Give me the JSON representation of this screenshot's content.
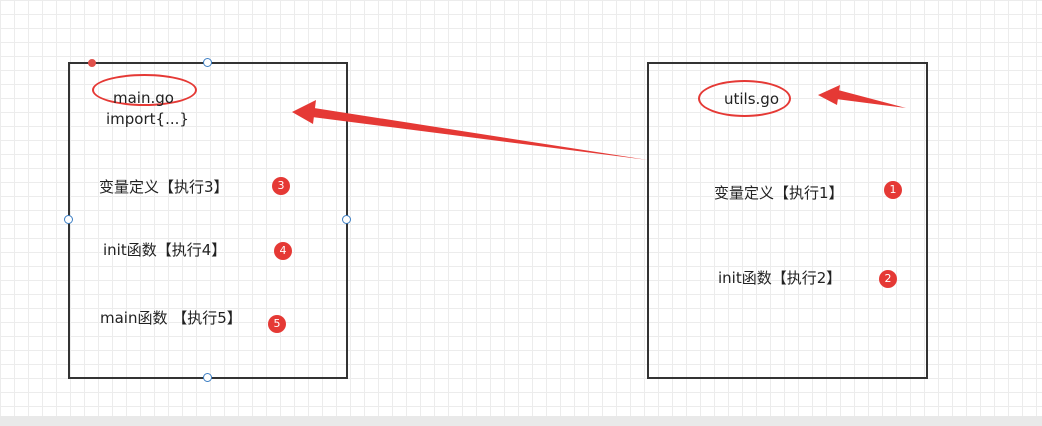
{
  "main_file": {
    "title": "main.go",
    "import_text": "import{...}",
    "steps": [
      {
        "label": "变量定义【执行3】",
        "order": "3"
      },
      {
        "label": "init函数【执行4】",
        "order": "4"
      },
      {
        "label": "main函数 【执行5】",
        "order": "5"
      }
    ]
  },
  "utils_file": {
    "title": "utils.go",
    "steps": [
      {
        "label": "变量定义【执行1】",
        "order": "1"
      },
      {
        "label": "init函数【执行2】",
        "order": "2"
      }
    ]
  },
  "colors": {
    "accent": "#e53935",
    "border": "#333333",
    "grid": "#ececec",
    "handle": "#3d7fc4"
  }
}
